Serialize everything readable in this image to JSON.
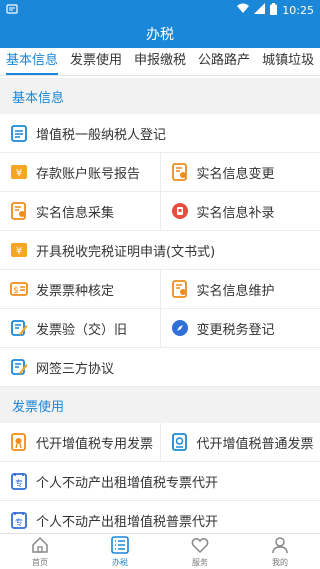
{
  "status": {
    "time": "10:25"
  },
  "title": "办税",
  "tabs": [
    "基本信息",
    "发票使用",
    "申报缴税",
    "公路路产",
    "城镇垃圾"
  ],
  "sections": [
    {
      "title": "基本信息",
      "items": [
        {
          "label": "增值税一般纳税人登记",
          "icon": "clipboard-icon",
          "color": "#1a87d8"
        },
        {
          "label": "存款账户账号报告",
          "icon": "yen-card-icon",
          "color": "#f5a623"
        },
        {
          "label": "实名信息变更",
          "icon": "id-doc-icon",
          "color": "#f08c1a"
        },
        {
          "label": "实名信息采集",
          "icon": "id-doc-icon",
          "color": "#f08c1a"
        },
        {
          "label": "实名信息补录",
          "icon": "red-badge-icon",
          "color": "#e84c3d"
        },
        {
          "label": "开具税收完税证明申请(文书式)",
          "icon": "yen-card-icon",
          "color": "#f5a623"
        },
        {
          "label": "发票票种核定",
          "icon": "money-icon",
          "color": "#f08c1a"
        },
        {
          "label": "实名信息维护",
          "icon": "id-doc-icon",
          "color": "#f08c1a"
        },
        {
          "label": "发票验（交）旧",
          "icon": "edit-doc-icon",
          "color": "#1a87d8"
        },
        {
          "label": "变更税务登记",
          "icon": "compass-icon",
          "color": "#2f6fd6"
        },
        {
          "label": "网签三方协议",
          "icon": "edit-doc-icon",
          "color": "#1a87d8"
        }
      ]
    },
    {
      "title": "发票使用",
      "items": [
        {
          "label": "代开增值税专用发票",
          "icon": "medal-doc-icon",
          "color": "#f08c1a"
        },
        {
          "label": "代开增值税普通发票",
          "icon": "stamp-doc-icon",
          "color": "#1a87d8"
        },
        {
          "label": "个人不动产出租增值税专票代开",
          "icon": "special-invoice-icon",
          "color": "#2f6fd6"
        },
        {
          "label": "个人不动产出租增值税普票代开",
          "icon": "special-invoice-icon",
          "color": "#2f6fd6"
        }
      ]
    }
  ],
  "nav": [
    {
      "label": "首页",
      "icon": "home-icon"
    },
    {
      "label": "办税",
      "icon": "list-icon",
      "active": true
    },
    {
      "label": "服务",
      "icon": "heart-icon"
    },
    {
      "label": "我的",
      "icon": "user-icon"
    }
  ]
}
